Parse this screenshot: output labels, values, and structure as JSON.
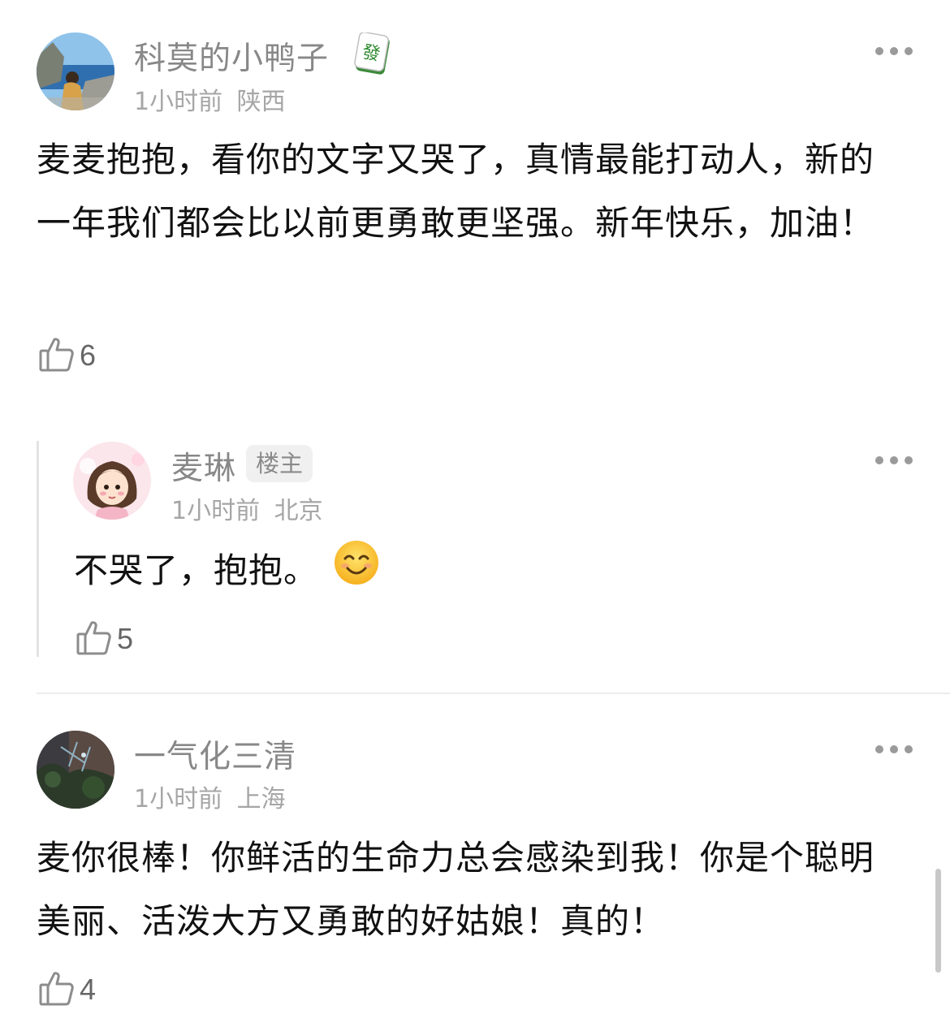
{
  "comments": [
    {
      "username": "科莫的小鸭子",
      "badge_icon": "mahjong-fa-tile-icon",
      "time": "1小时前",
      "location": "陕西",
      "body": "麦麦抱抱，看你的文字又哭了，真情最能打动人，新的一年我们都会比以前更勇敢更坚强。新年快乐，加油！",
      "likes": "6"
    },
    {
      "username": "麦琳",
      "op_label": "楼主",
      "time": "1小时前",
      "location": "北京",
      "body": "不哭了，抱抱。",
      "emoji_icon": "smiling-face-emoji-icon",
      "likes": "5"
    },
    {
      "username": "一气化三清",
      "time": "1小时前",
      "location": "上海",
      "body": "麦你很棒！你鲜活的生命力总会感染到我！你是个聪明美丽、活泼大方又勇敢的好姑娘！真的！",
      "likes": "4"
    }
  ],
  "colors": {
    "username": "#888888",
    "meta": "#a6a6a6",
    "body": "#111111",
    "icon": "#8c8c8c"
  }
}
